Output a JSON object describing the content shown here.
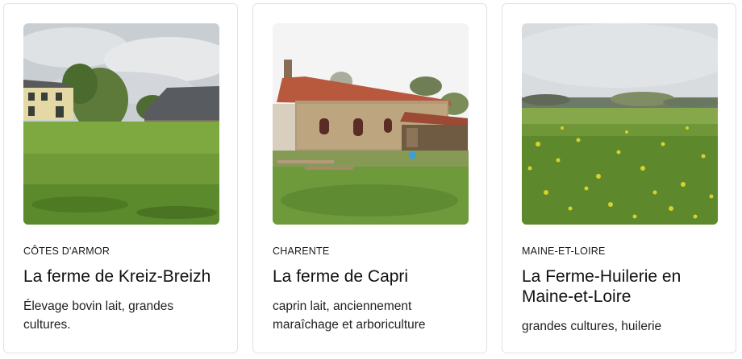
{
  "cards": [
    {
      "region": "CÔTES D'ARMOR",
      "title": "La ferme de Kreiz-Breizh",
      "description": "Élevage bovin lait, grandes cultures."
    },
    {
      "region": "CHARENTE",
      "title": "La ferme de Capri",
      "description": "caprin lait, anciennement maraîchage et arboriculture"
    },
    {
      "region": "MAINE-ET-LOIRE",
      "title": "La Ferme-Huilerie en Maine-et-Loire",
      "description": "grandes cultures, huilerie"
    }
  ]
}
